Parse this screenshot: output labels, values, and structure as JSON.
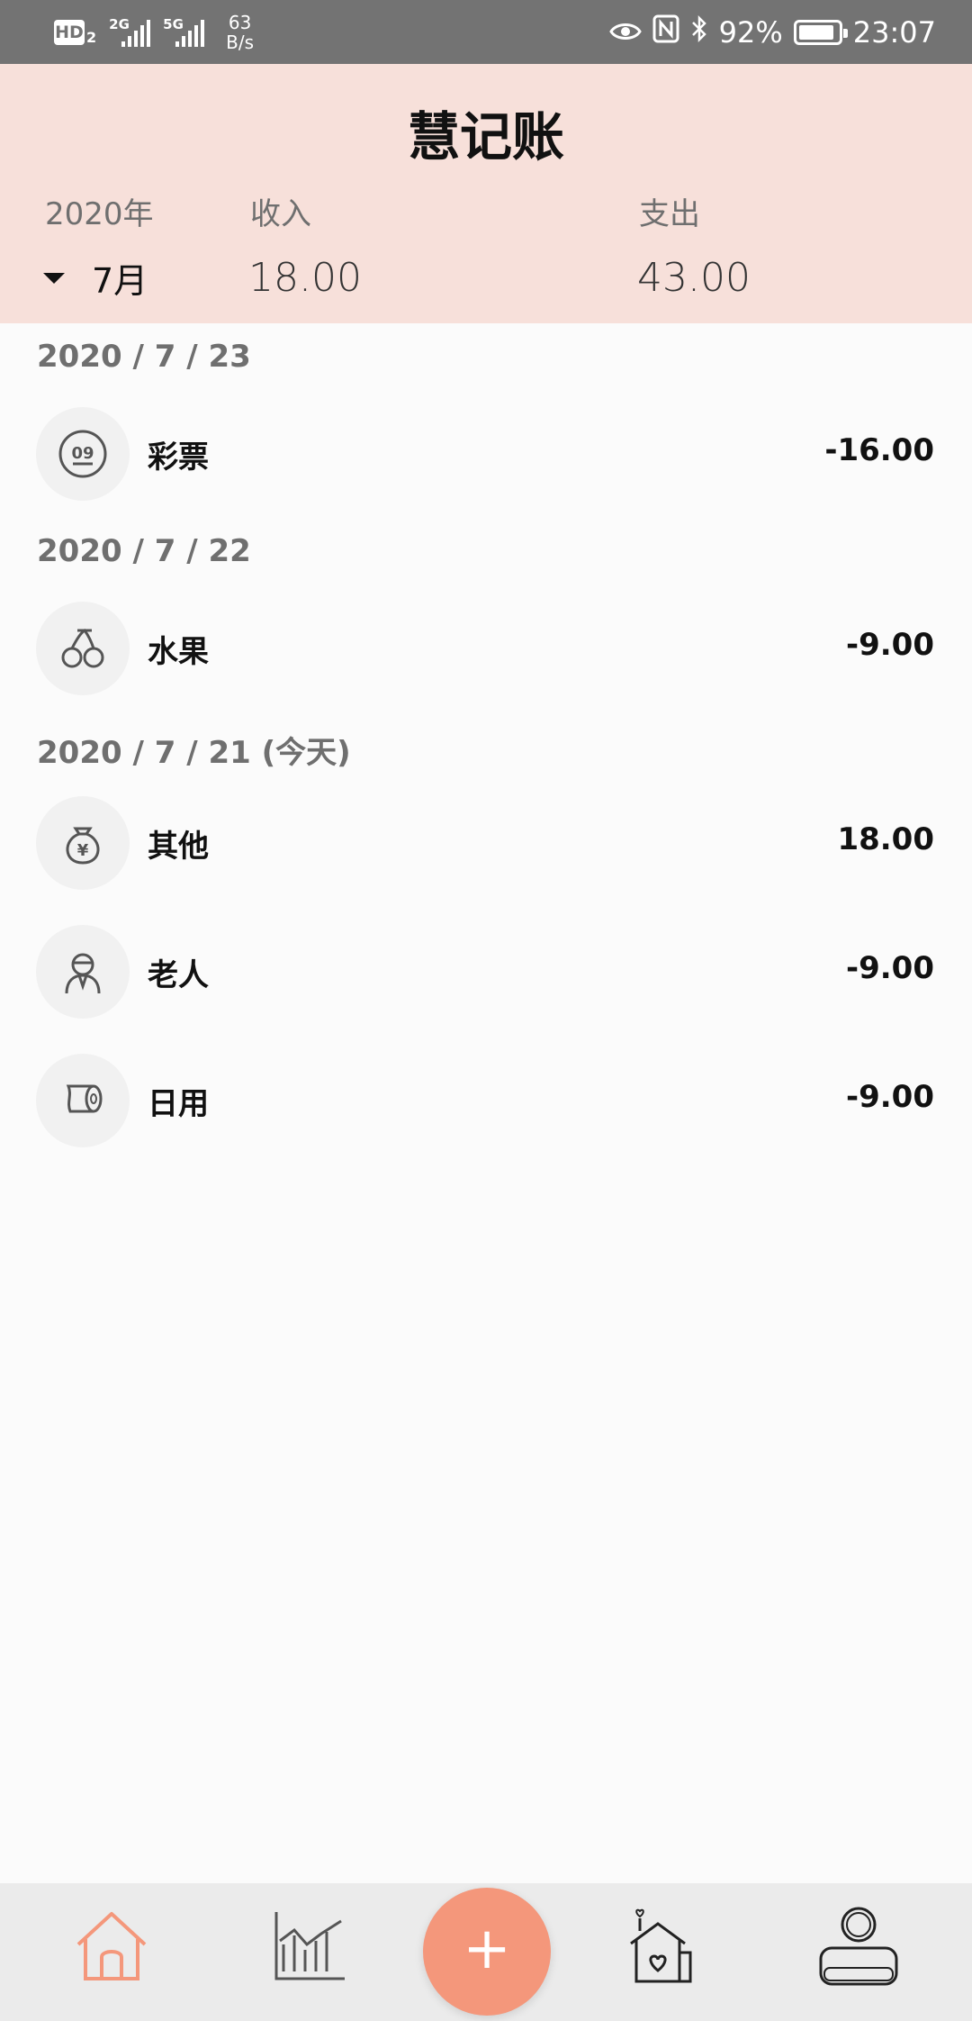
{
  "status_bar": {
    "hd_badge": "HD",
    "hd_sub": "2",
    "signal1": "2G",
    "signal2": "5G",
    "net_speed_value": "63",
    "net_speed_unit": "B/s",
    "battery_percent": "92%",
    "time": "23:07",
    "battery_level": 0.92
  },
  "header": {
    "title": "慧记账",
    "year": "2020年",
    "month": "7月",
    "income_label": "收入",
    "income_value": "18.00",
    "expense_label": "支出",
    "expense_value": "43.00",
    "background_color": "#f7e0da"
  },
  "days": [
    {
      "date": "2020 / 7 / 23",
      "records": [
        {
          "category": "彩票",
          "amount": "-16.00",
          "icon": "lottery-icon"
        }
      ]
    },
    {
      "date": "2020 / 7 / 22",
      "records": [
        {
          "category": "水果",
          "amount": "-9.00",
          "icon": "cherry-icon"
        }
      ]
    },
    {
      "date": "2020 / 7 / 21 (今天)",
      "records": [
        {
          "category": "其他",
          "amount": "18.00",
          "icon": "money-bag-icon"
        },
        {
          "category": "老人",
          "amount": "-9.00",
          "icon": "elder-icon"
        },
        {
          "category": "日用",
          "amount": "-9.00",
          "icon": "toilet-paper-icon"
        }
      ]
    }
  ],
  "bottom_nav": {
    "items": [
      "home-icon",
      "chart-icon",
      "add-icon",
      "house-heart-icon",
      "profile-icon"
    ],
    "add_label": "+",
    "accent_color": "#f4977b"
  }
}
